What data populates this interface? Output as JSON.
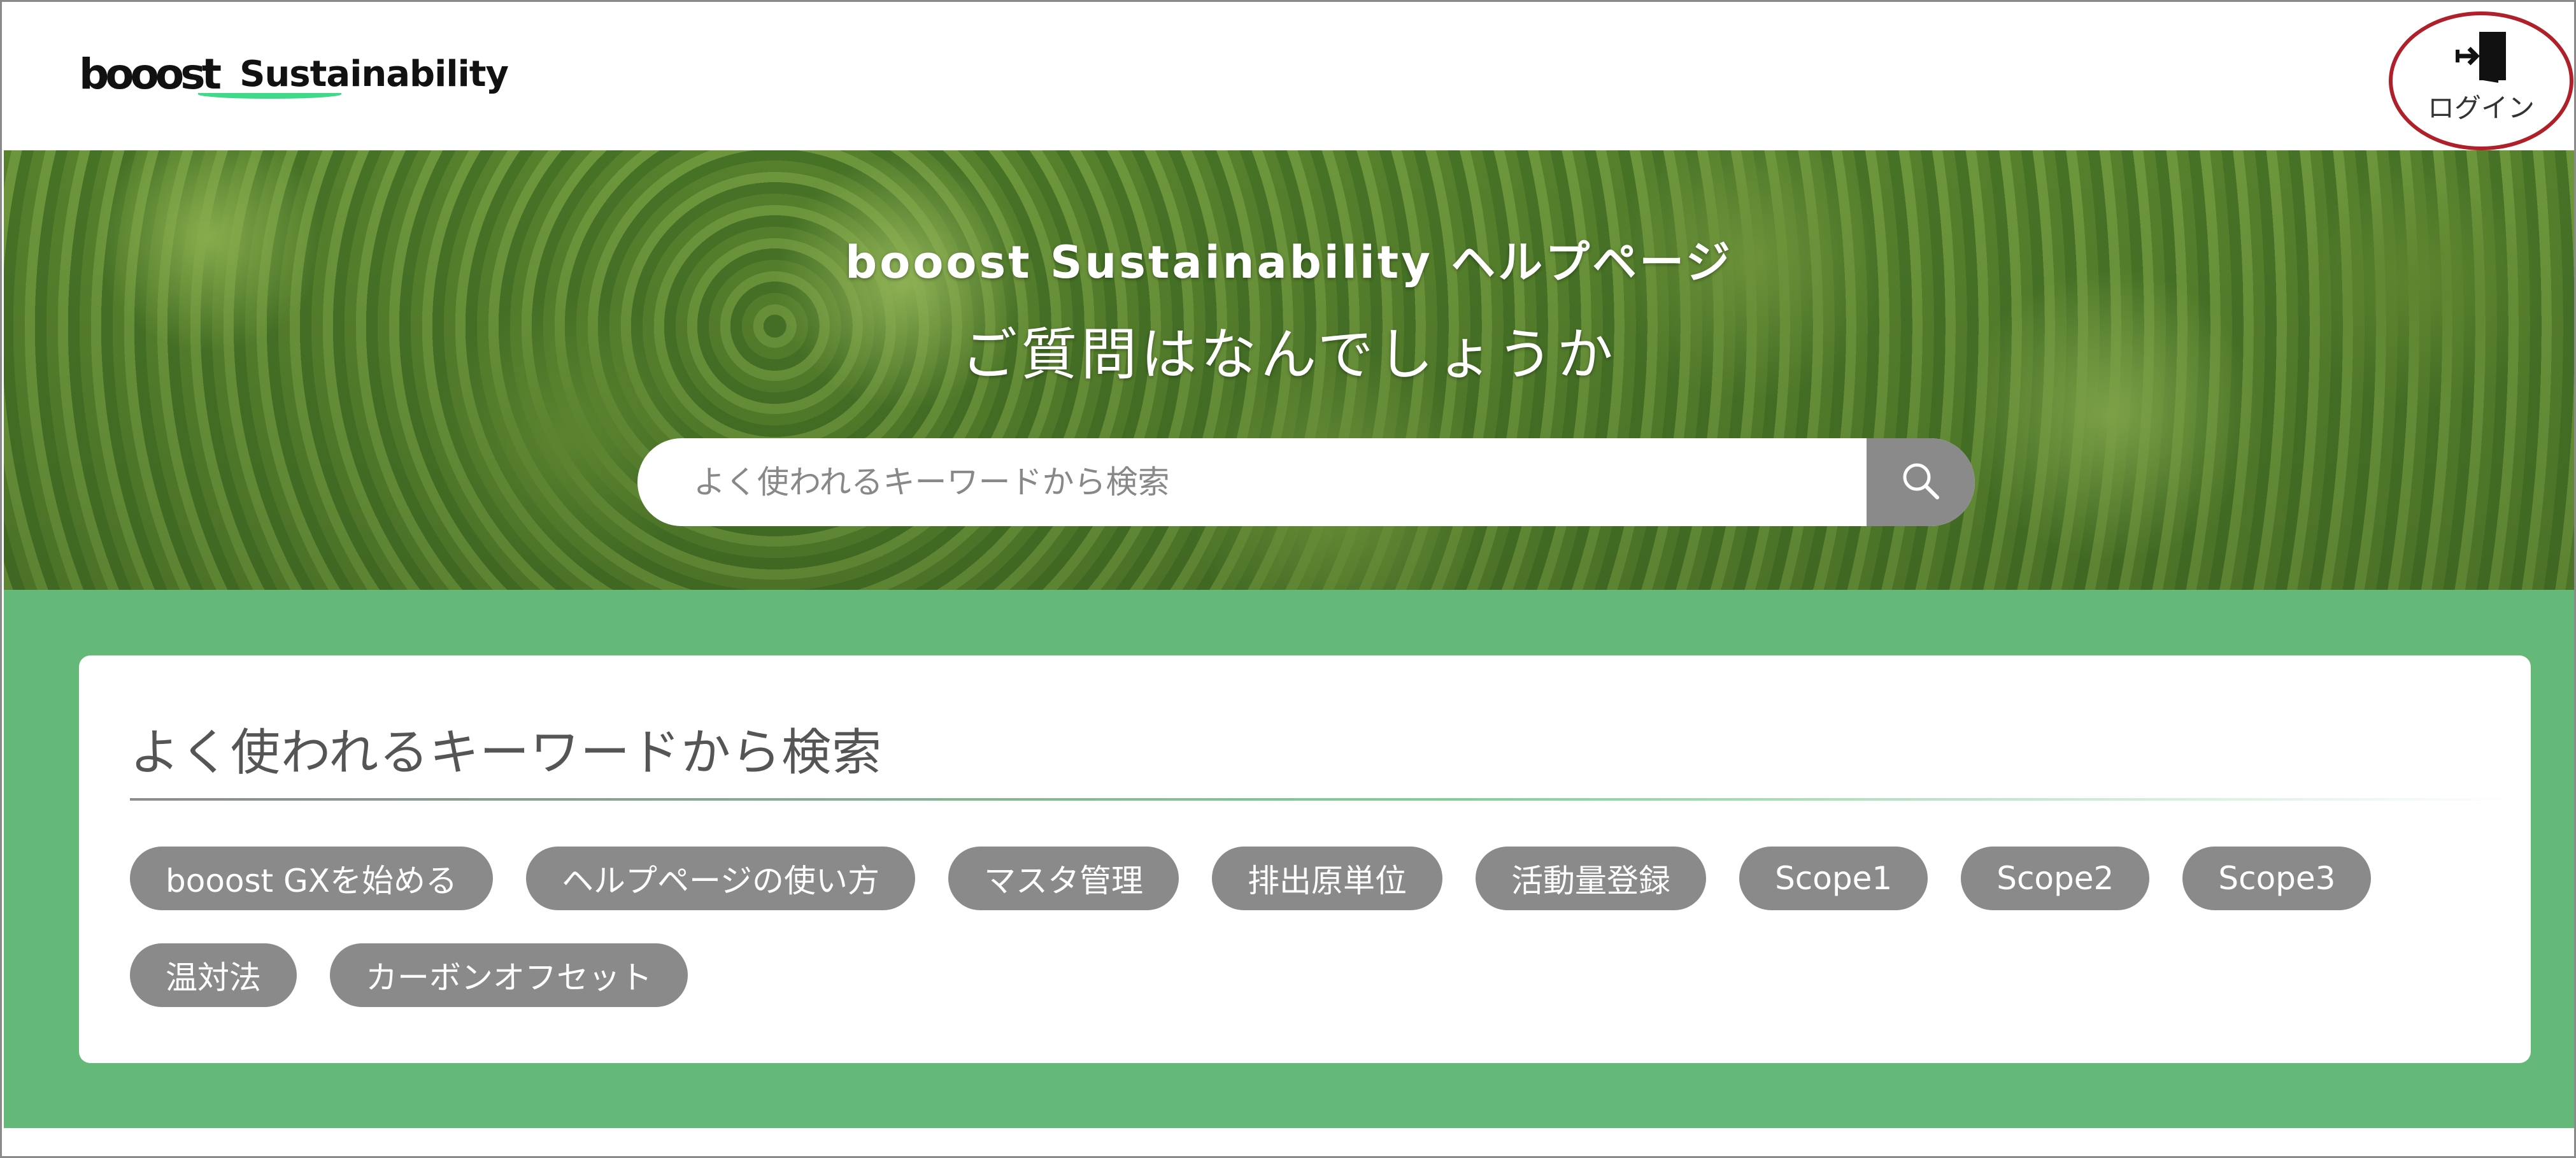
{
  "header": {
    "logo_brand": "booost",
    "logo_product": "Sustainability",
    "login_label": "ログイン",
    "login_icon": "login-door-icon"
  },
  "hero": {
    "title": "booost Sustainability ヘルプページ",
    "subtitle": "ご質問はなんでしょうか",
    "search_placeholder": "よく使われるキーワードから検索",
    "search_icon": "search-icon"
  },
  "keywords": {
    "title": "よく使われるキーワードから検索",
    "tags": [
      "booost GXを始める",
      "ヘルプページの使い方",
      "マスタ管理",
      "排出原単位",
      "活動量登録",
      "Scope1",
      "Scope2",
      "Scope3",
      "温対法",
      "カーボンオフセット"
    ]
  },
  "colors": {
    "accent_green": "#64b978",
    "logo_underline": "#3fd98a",
    "tag_gray": "#8a8a8a",
    "highlight_circle": "#b0202a"
  }
}
